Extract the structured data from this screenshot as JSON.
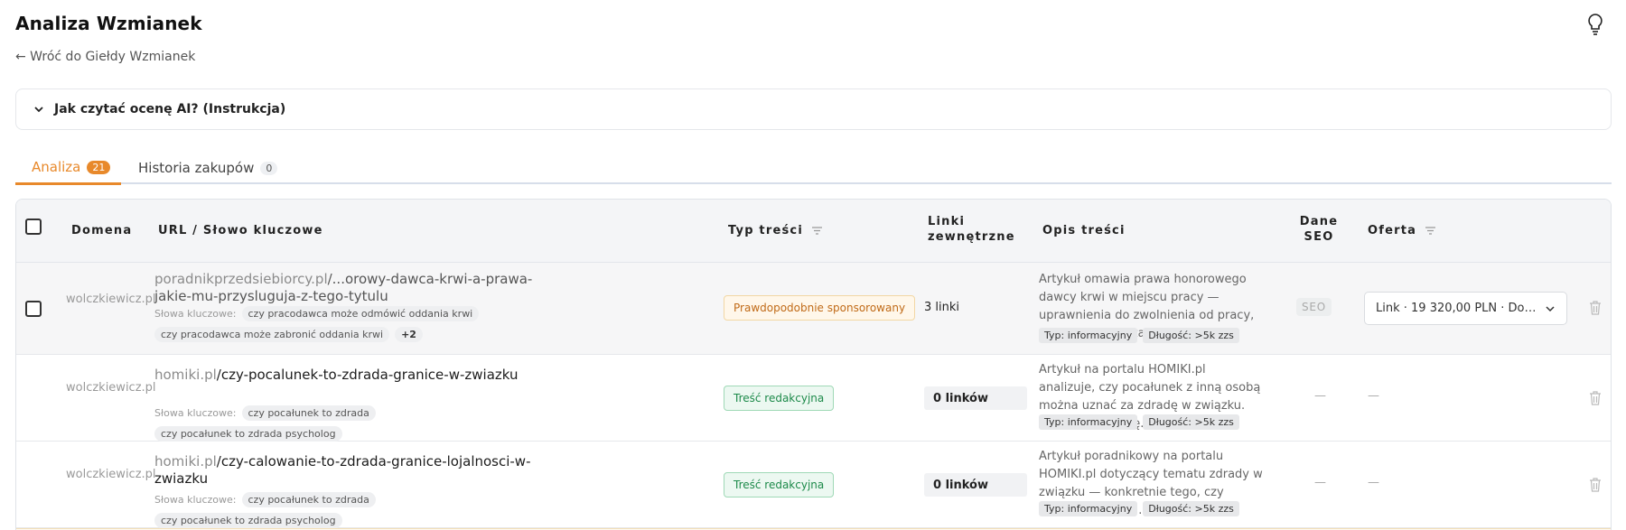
{
  "app": {
    "title": "Analiza Wzmianek",
    "back_link": "← Wróć do Giełdy Wzmianek",
    "instructions_label": "Jak czytać ocenę AI? (Instrukcja)",
    "icons": {
      "help": "lightbulb-icon",
      "collapse": "chevron-down-icon"
    }
  },
  "tabs": [
    {
      "label": "Analiza",
      "count": "21",
      "active": true
    },
    {
      "label": "Historia zakupów",
      "count": "0",
      "active": false
    }
  ],
  "table": {
    "headers": {
      "domain": "Domena",
      "url": "URL / Słowo kluczowe",
      "content_type": "Typ treści",
      "external_links": "Linki zewnętrzne",
      "description": "Opis treści",
      "seo_data": "Dane SEO",
      "offer": "Oferta"
    },
    "keywords_label": "Słowa kluczowe:",
    "rows": [
      {
        "domain": "wolczkiewicz.pl",
        "url_host": "poradnikprzedsiebiorcy.pl",
        "url_path": "/...orowy-dawca-krwi-a-prawa-jakie-mu-przysluguja-z-tego-tytulu",
        "keywords": [
          "czy pracodawca może odmówić oddania krwi",
          "czy pracodawca może zabronić oddania krwi"
        ],
        "keywords_more": "+2",
        "content_type": "Prawdopodobnie sponsorowany",
        "external_links": "3 linki",
        "description": "Artykuł omawia prawa honorowego dawcy krwi w miejscu pracy — uprawnienia do zwolnienia od pracy, wynagrodzenie za...",
        "tags": [
          "Typ: informacyjny",
          "Długość: >5k zzs"
        ],
        "seo": "SEO",
        "offer": "Link · 19 320,00 PLN · DoFollo...",
        "has_checkbox": true
      },
      {
        "domain": "wolczkiewicz.pl",
        "url_host": "homiki.pl",
        "url_path": "/czy-pocalunek-to-zdrada-granice-w-zwiazku",
        "keywords": [
          "czy pocałunek to zdrada",
          "czy pocałunek to zdrada psycholog"
        ],
        "content_type": "Treść redakcyjna",
        "external_links": "0 linków",
        "description": "Artykuł na portalu HOMIKI.pl analizuje, czy pocałunek z inną osobą można uznać za zdradę w związku. Omawia definicję...",
        "tags": [
          "Typ: informacyjny",
          "Długość: >5k zzs"
        ],
        "seo": "—",
        "offer": "—"
      },
      {
        "domain": "wolczkiewicz.pl",
        "url_host": "homiki.pl",
        "url_path": "/czy-calowanie-to-zdrada-granice-lojalnosci-w-zwiazku",
        "keywords": [
          "czy pocałunek to zdrada",
          "czy pocałunek to zdrada psycholog"
        ],
        "content_type": "Treść redakcyjna",
        "external_links": "0 linków",
        "description": "Artykuł poradnikowy na portalu HOMIKI.pl dotyczący tematu zdrady w związku — konkretnie tego, czy całowanie osoby...",
        "tags": [
          "Typ: informacyjny",
          "Długość: >5k zzs"
        ],
        "seo": "—",
        "offer": "—"
      }
    ]
  },
  "colors": {
    "accent": "#e8892b",
    "editorial": "#1d8a4a",
    "sponsored": "#c06a17"
  }
}
